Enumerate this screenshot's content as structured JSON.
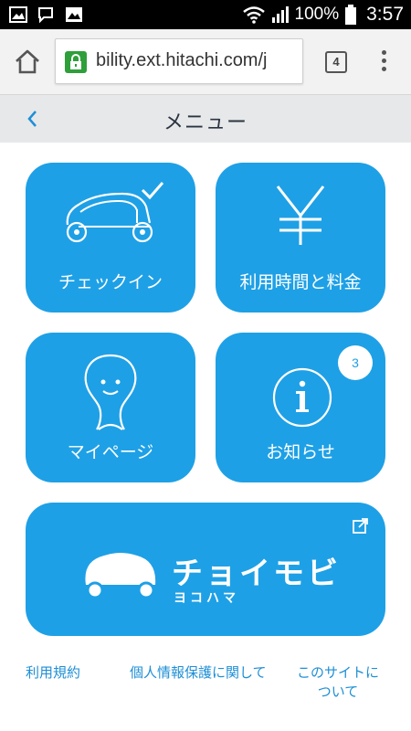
{
  "status_bar": {
    "battery": "100%",
    "time": "3:57",
    "icons": [
      "image-icon",
      "chat-icon",
      "picture-icon",
      "wifi-icon",
      "signal-icon",
      "battery-icon"
    ]
  },
  "browser": {
    "url": "bility.ext.hitachi.com/j",
    "tab_count": "4",
    "icons": [
      "home-icon",
      "lock-icon",
      "overflow-menu-icon"
    ]
  },
  "header": {
    "title": "メニュー",
    "back_icon": "chevron-left-icon"
  },
  "tiles": [
    {
      "label": "チェックイン",
      "icon": "car-check-icon"
    },
    {
      "label": "利用時間と料金",
      "icon": "yen-icon"
    },
    {
      "label": "マイページ",
      "icon": "smiley-icon"
    },
    {
      "label": "お知らせ",
      "icon": "info-icon",
      "badge": "3"
    }
  ],
  "banner": {
    "logo_text": "チョイモビ",
    "logo_subtext": "ヨコハマ",
    "icon": "external-link-icon"
  },
  "footer": {
    "links": [
      "利用規約",
      "個人情報保護に関して",
      "このサイトに",
      "ついて"
    ]
  },
  "colors": {
    "accent": "#1ea0e6",
    "header_bg": "#e6e8ea",
    "link": "#1e8fd6"
  }
}
